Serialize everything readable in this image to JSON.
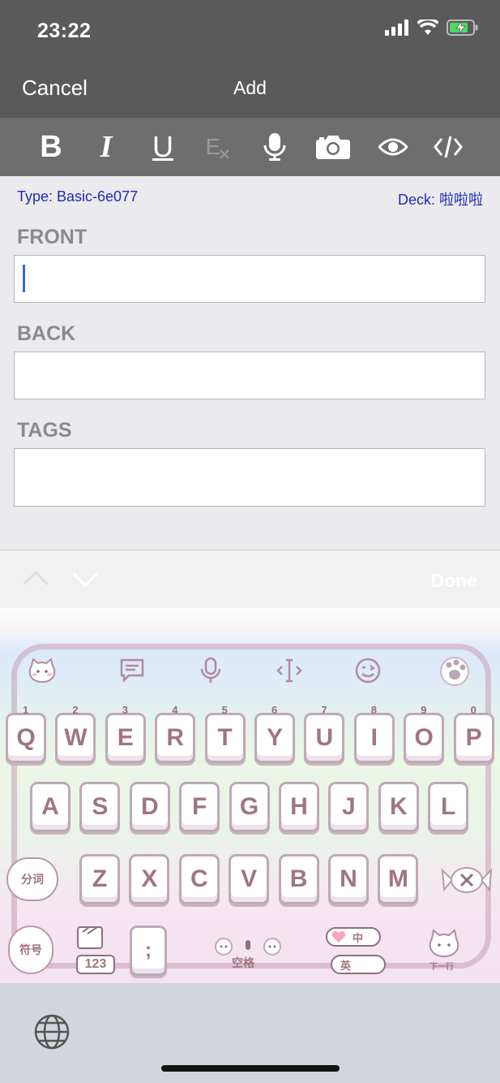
{
  "status_bar": {
    "time": "23:22"
  },
  "nav": {
    "cancel": "Cancel",
    "title": "Add"
  },
  "toolbar": {
    "bold": "B",
    "italic": "I",
    "underline": "U",
    "clear_format": "E"
  },
  "note": {
    "type_label": "Type: Basic-6e077",
    "deck_label": "Deck: 啦啦啦",
    "fields": [
      {
        "label": "FRONT",
        "value": ""
      },
      {
        "label": "BACK",
        "value": ""
      },
      {
        "label": "TAGS",
        "value": ""
      }
    ]
  },
  "accessory": {
    "done": "Done"
  },
  "keyboard": {
    "row1": [
      {
        "key": "Q",
        "num": "1"
      },
      {
        "key": "W",
        "num": "2"
      },
      {
        "key": "E",
        "num": "3"
      },
      {
        "key": "R",
        "num": "4"
      },
      {
        "key": "T",
        "num": "5"
      },
      {
        "key": "Y",
        "num": "6"
      },
      {
        "key": "U",
        "num": "7"
      },
      {
        "key": "I",
        "num": "8"
      },
      {
        "key": "O",
        "num": "9"
      },
      {
        "key": "P",
        "num": "0"
      }
    ],
    "row2": [
      "A",
      "S",
      "D",
      "F",
      "G",
      "H",
      "J",
      "K",
      "L"
    ],
    "row3": [
      "Z",
      "X",
      "C",
      "V",
      "B",
      "N",
      "M"
    ],
    "segment_key": "分词",
    "symbol_key": "符号",
    "number_key": "123",
    "punct_key": ";",
    "space_key": "空格",
    "lang_zh": "中",
    "lang_en": "英",
    "return_key": "下一行"
  }
}
